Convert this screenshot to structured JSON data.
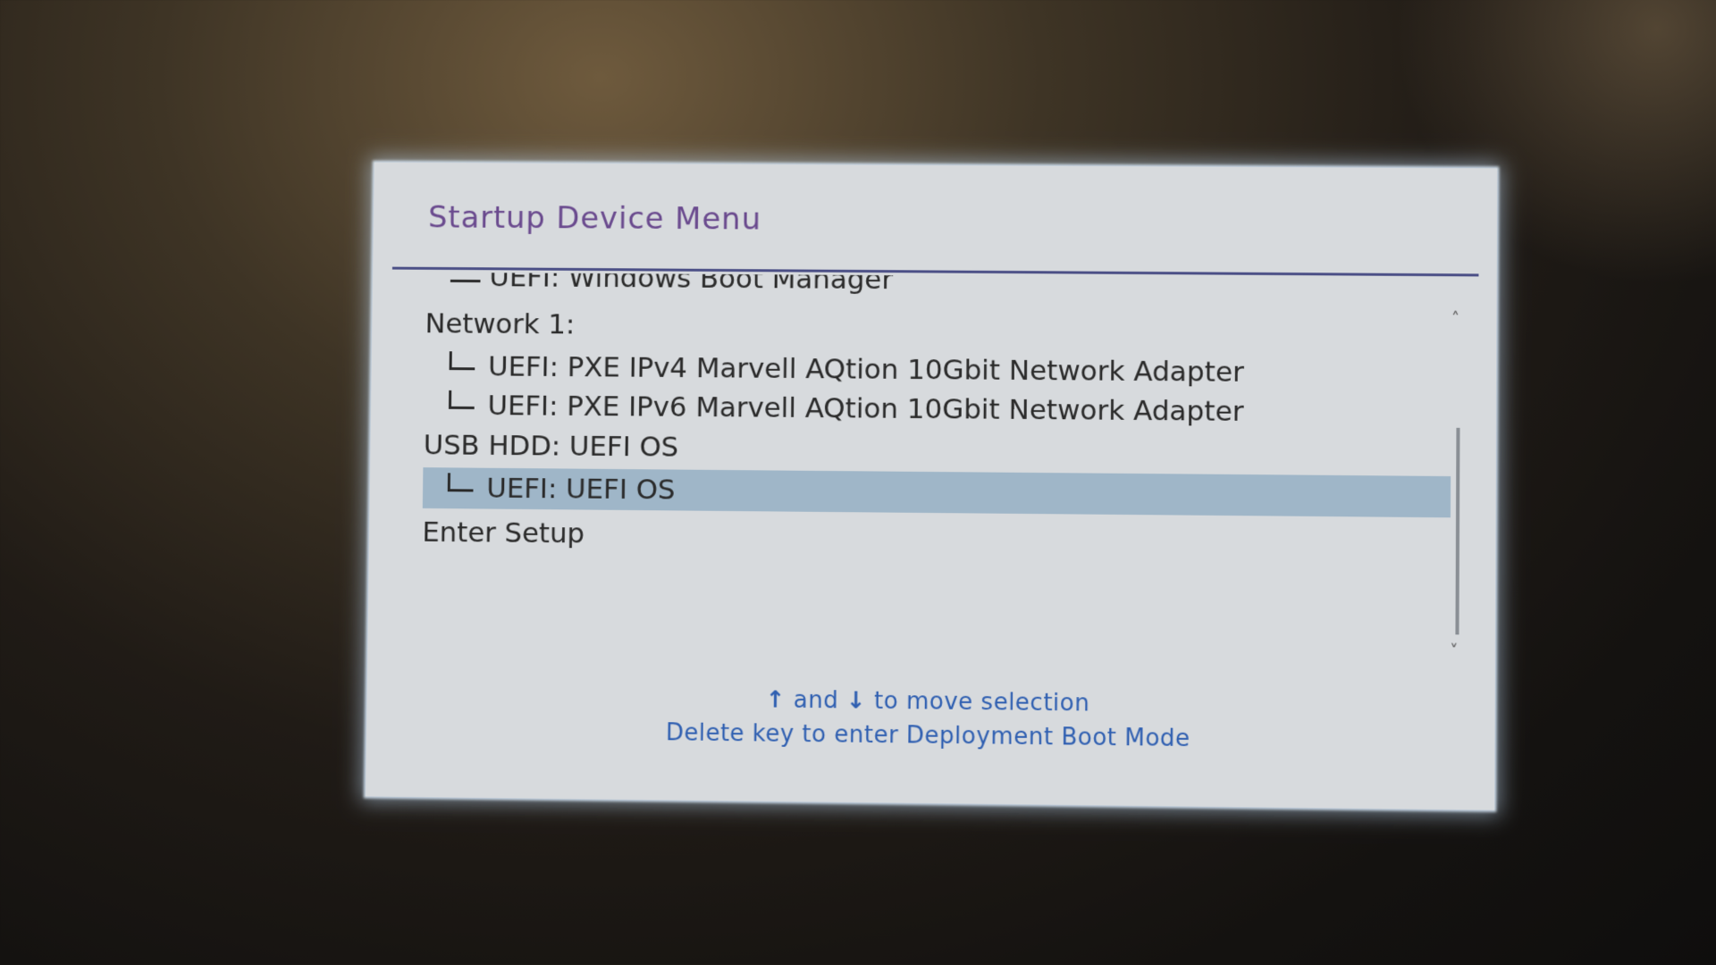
{
  "menu": {
    "title": "Startup Device Menu",
    "items": [
      {
        "label": "UEFI: Windows Boot Manager",
        "level": "child",
        "clipped": true
      },
      {
        "label": "Network 1:",
        "level": "parent"
      },
      {
        "label": "UEFI: PXE IPv4 Marvell AQtion 10Gbit Network Adapter",
        "level": "child"
      },
      {
        "label": "UEFI: PXE IPv6 Marvell AQtion 10Gbit Network Adapter",
        "level": "child"
      },
      {
        "label": "USB HDD: UEFI OS",
        "level": "parent"
      },
      {
        "label": "UEFI: UEFI OS",
        "level": "child",
        "selected": true
      },
      {
        "label": "Enter Setup",
        "level": "parent"
      }
    ],
    "scrollbar": {
      "up_glyph": "˄",
      "down_glyph": "˅"
    }
  },
  "hints": {
    "up_arrow": "↑",
    "and_text": " and ",
    "down_arrow": "↓",
    "move_text": " to move selection",
    "deployment": "Delete key to enter Deployment Boot Mode"
  },
  "colors": {
    "title": "#6a4a8e",
    "rule": "#4b4f86",
    "panel": "#d7dadd",
    "selection": "#9fb6c8",
    "hint": "#2f5fb1"
  }
}
